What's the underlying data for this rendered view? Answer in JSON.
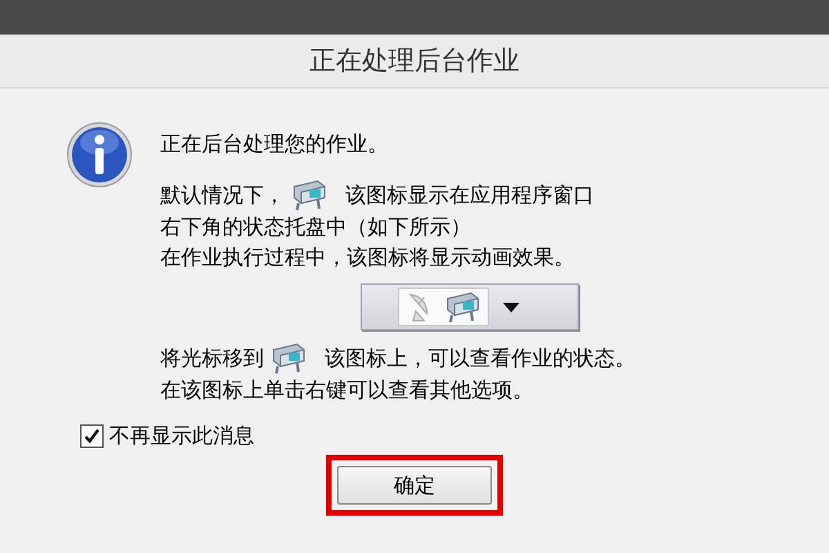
{
  "window": {
    "title": "正在处理后台作业"
  },
  "message": [
    {
      "kind": "heading",
      "text": "正在后台处理您的作业。"
    },
    {
      "kind": "icon_line",
      "before": "默认情况下，",
      "after": "该图标显示在应用程序窗口"
    },
    {
      "kind": "line",
      "text": "右下角的状态托盘中（如下所示）"
    },
    {
      "kind": "line",
      "text": "在作业执行过程中，该图标将显示动画效果。"
    },
    {
      "kind": "tray"
    },
    {
      "kind": "icon_line",
      "before": "将光标移到",
      "after": "该图标上，可以查看作业的状态。"
    },
    {
      "kind": "line",
      "text": "在该图标上单击右键可以查看其他选项。"
    }
  ],
  "checkbox": {
    "label": "不再显示此消息",
    "checked": true
  },
  "button": {
    "label": "确定",
    "highlighted": true
  }
}
